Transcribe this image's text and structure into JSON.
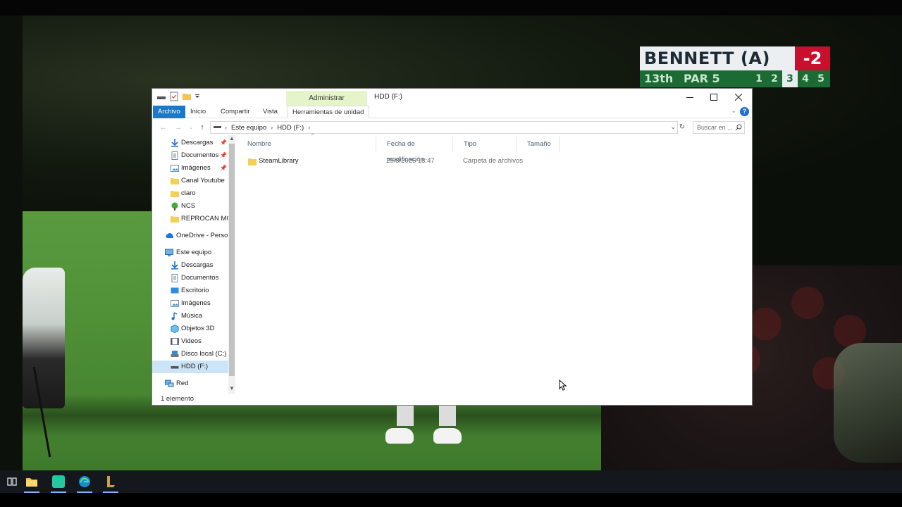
{
  "scoreboard": {
    "player": "BENNETT (A)",
    "score": "-2",
    "hole": "13th",
    "par": "PAR 5",
    "holes": [
      "1",
      "2",
      "3",
      "4",
      "5"
    ],
    "current_hole_index": 2,
    "colors": {
      "name_bg": "#eceff1",
      "score_bg": "#c8102e",
      "info_bg": "#1d6b34"
    }
  },
  "window": {
    "title": "HDD (F:)",
    "context_tab": "Administrar",
    "ribbon_tabs": [
      "Archivo",
      "Inicio",
      "Compartir",
      "Vista",
      "Herramientas de unidad"
    ],
    "help": "?",
    "address": {
      "crumbs": [
        "Este equipo",
        "HDD (F:)"
      ]
    },
    "search_placeholder": "Buscar en ...",
    "columns": [
      "Nombre",
      "Fecha de modificación",
      "Tipo",
      "Tamaño"
    ],
    "files": [
      {
        "name": "SteamLibrary",
        "modified": "25/8/2025 18:47",
        "type": "Carpeta de archivos",
        "size": ""
      }
    ],
    "status": "1 elemento",
    "accent": "#1979ca"
  },
  "nav": {
    "quick_access": [
      {
        "label": "Descargas",
        "icon": "download-arrow-icon",
        "pinned": true
      },
      {
        "label": "Documentos",
        "icon": "document-icon",
        "pinned": true
      },
      {
        "label": "Imágenes",
        "icon": "pictures-icon",
        "pinned": true
      },
      {
        "label": "Canal Youtube",
        "icon": "folder-icon",
        "pinned": false
      },
      {
        "label": "claro",
        "icon": "folder-icon",
        "pinned": false
      },
      {
        "label": "NCS",
        "icon": "tree-folder-icon",
        "pinned": false
      },
      {
        "label": "REPROCAN MOI",
        "icon": "folder-icon",
        "pinned": false
      }
    ],
    "onedrive": "OneDrive - Persor",
    "this_pc": "Este equipo",
    "this_pc_items": [
      {
        "label": "Descargas",
        "icon": "download-arrow-icon"
      },
      {
        "label": "Documentos",
        "icon": "document-icon"
      },
      {
        "label": "Escritorio",
        "icon": "desktop-icon"
      },
      {
        "label": "Imágenes",
        "icon": "pictures-icon"
      },
      {
        "label": "Música",
        "icon": "music-icon"
      },
      {
        "label": "Objetos 3D",
        "icon": "cube-icon"
      },
      {
        "label": "Videos",
        "icon": "video-icon"
      },
      {
        "label": "Disco local (C:)",
        "icon": "disk-icon"
      },
      {
        "label": "HDD (F:)",
        "icon": "drive-icon",
        "selected": true
      }
    ],
    "network": "Red"
  },
  "taskbar": {
    "items": [
      "task-view-icon",
      "file-explorer-icon",
      "app-icon",
      "edge-icon",
      "launcher-icon"
    ]
  }
}
